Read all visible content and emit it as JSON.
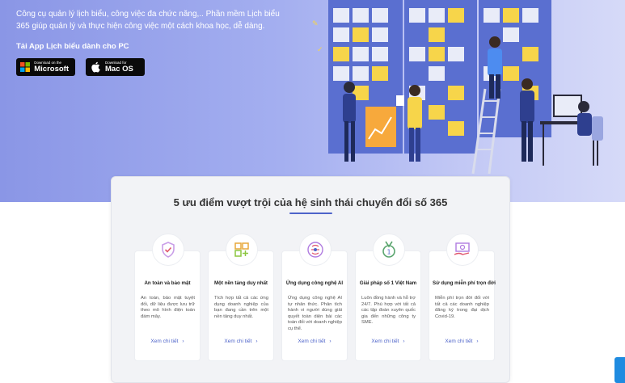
{
  "hero": {
    "description": "Công cụ quản lý lịch biểu, công việc đa chức năng,.. Phần mềm Lịch biểu 365 giúp quản lý và thực hiện công việc một cách khoa học, dễ dàng.",
    "download_heading": "Tải App Lịch biểu dành cho PC",
    "stores": [
      {
        "small": "Download on the",
        "big": "Microsoft",
        "icon": "windows-icon"
      },
      {
        "small": "Download for",
        "big": "Mac OS",
        "icon": "apple-icon"
      }
    ]
  },
  "advantages": {
    "title": "5 ưu điểm vượt trội của hệ sinh thái chuyển đổi số 365",
    "accent": "#4d63c9",
    "cards": [
      {
        "title": "An toàn và bảo mật",
        "desc": "An toàn, bảo mật tuyệt đối, dữ liệu được lưu trữ theo mô hình điện toán đám mây.",
        "link": "Xem chi tiết",
        "icon": "shield-check-icon"
      },
      {
        "title": "Một nền tảng duy nhất",
        "desc": "Tích hợp tất cả các ứng dụng doanh nghiệp của bạn đang cần trên một nền tảng duy nhất.",
        "link": "Xem chi tiết",
        "icon": "app-grid-plus-icon"
      },
      {
        "title": "Ứng dụng công nghệ AI",
        "desc": "Ứng dụng công nghệ AI tự nhân thức. Phân tích hành vi người dùng giải quyết toàn diện bài các toàn đối với doanh nghiệp cụ thể.",
        "link": "Xem chi tiết",
        "icon": "brain-ai-icon"
      },
      {
        "title": "Giải pháp số 1 Việt Nam",
        "desc": "Luôn đồng hành và hỗ trợ 24/7. Phù hợp với tất cả các tập đoàn xuyên quốc gia đến những công ty SME.",
        "link": "Xem chi tiết",
        "icon": "medal-icon"
      },
      {
        "title": "Sử dụng miễn phí trọn đời",
        "desc": "Miễn phí trọn đời đối với tất cả các doanh nghiệp đăng ký trong đại dịch Covid-19.",
        "link": "Xem chi tiết",
        "icon": "money-hand-icon"
      }
    ]
  }
}
